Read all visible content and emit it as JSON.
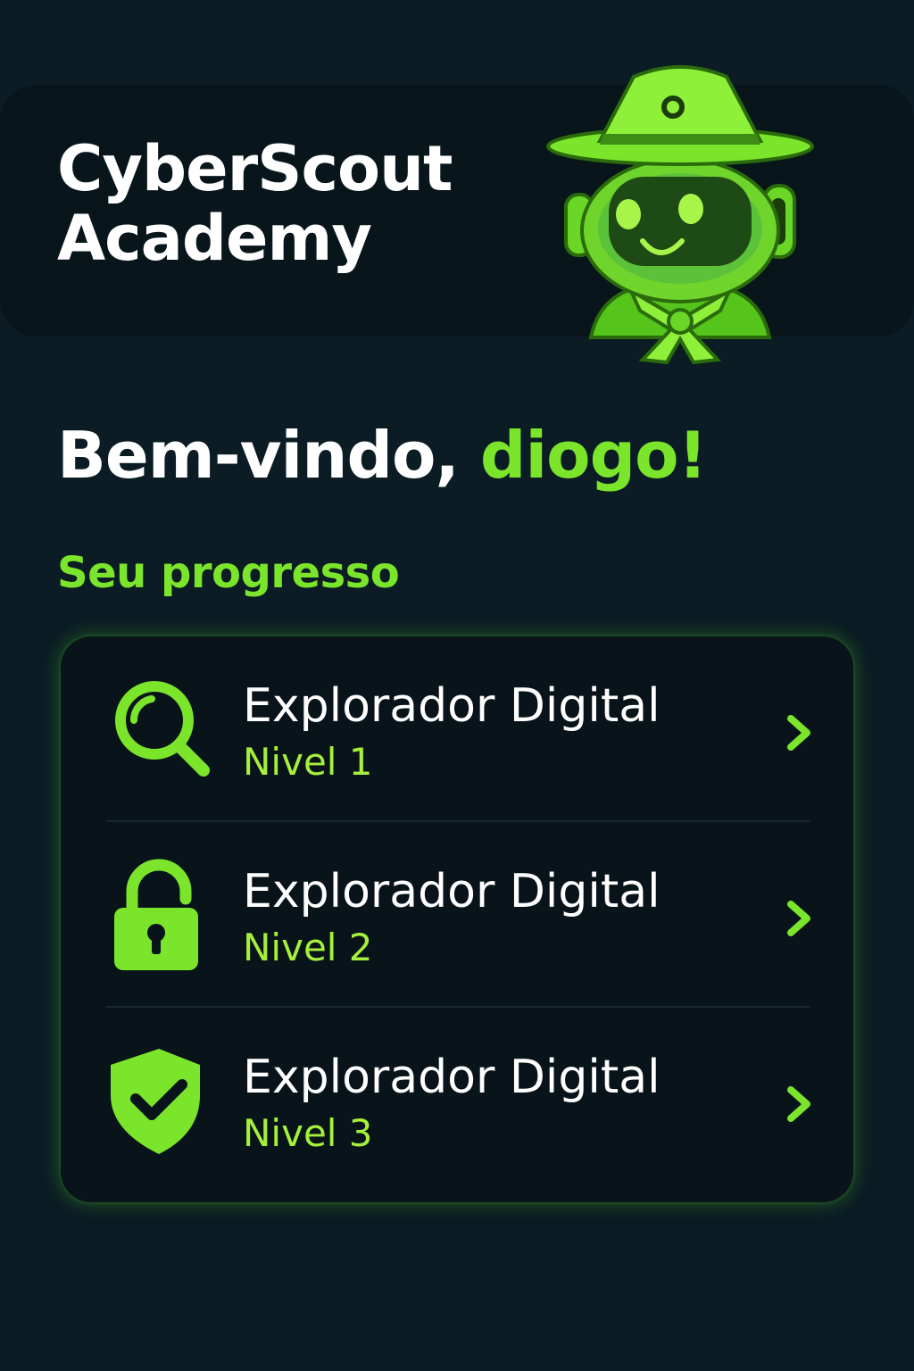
{
  "app": {
    "title_line1": "CyberScout",
    "title_line2": "Academy",
    "mascot_icon": "scout-robot-mascot-icon"
  },
  "welcome": {
    "greeting": "Bem-vindo, ",
    "username": "diogo!"
  },
  "progress": {
    "section_title": "Seu progresso",
    "items": [
      {
        "title": "Explorador Digital",
        "level": "Nivel 1",
        "icon": "magnifier-icon"
      },
      {
        "title": "Explorador Digital",
        "level": "Nivel 2",
        "icon": "padlock-icon"
      },
      {
        "title": "Explorador Digital",
        "level": "Nivel 3",
        "icon": "shield-check-icon"
      }
    ]
  },
  "colors": {
    "background": "#0b1c24",
    "card": "#08141a",
    "accent": "#7be52c",
    "text": "#ffffff"
  }
}
